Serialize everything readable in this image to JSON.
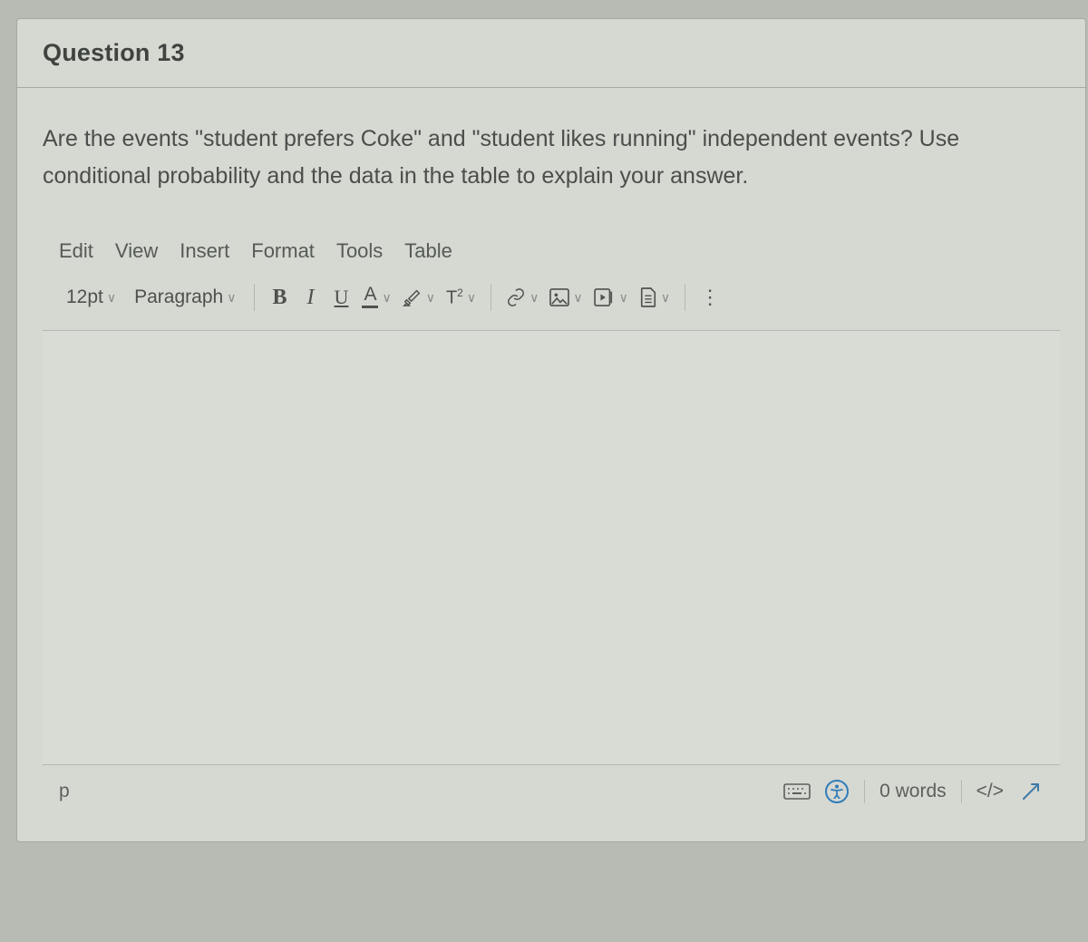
{
  "header": {
    "title": "Question 13"
  },
  "prompt": "Are the events \"student prefers Coke\" and \"student likes running\" independent events? Use conditional probability and the data in the table to explain your answer.",
  "menu": {
    "edit": "Edit",
    "view": "View",
    "insert": "Insert",
    "format": "Format",
    "tools": "Tools",
    "table": "Table"
  },
  "toolbar": {
    "font_size": "12pt",
    "block_format": "Paragraph",
    "bold": "B",
    "italic": "I",
    "underline": "U",
    "text_color": "A",
    "superscript": "T",
    "superscript_exp": "2"
  },
  "status": {
    "path": "p",
    "word_count": "0 words",
    "html_view": "</>"
  }
}
